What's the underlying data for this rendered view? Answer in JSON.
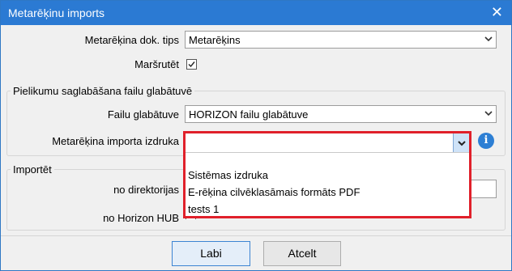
{
  "window": {
    "title": "Metarēķinu imports"
  },
  "form": {
    "doc_type_label": "Metarēķina dok. tips",
    "doc_type_value": "Metarēķins",
    "route_label": "Maršrutēt",
    "route_checked": true
  },
  "attachments_group": {
    "title": "Pielikumu saglabāšana failu glabātuvē",
    "storage_label": "Failu glabātuve",
    "storage_value": "HORIZON failu glabātuve",
    "print_label": "Metarēķina importa izdruka",
    "print_value": "",
    "print_options": [
      "Sistēmas izdruka",
      "E-rēķina cilvēklasāmais formāts PDF",
      "tests 1"
    ]
  },
  "import_group": {
    "title": "Importēt",
    "from_dir_label": "no direktorijas",
    "from_hub_label": "no Horizon HUB"
  },
  "footer": {
    "ok_label": "Labi",
    "cancel_label": "Atcelt"
  }
}
